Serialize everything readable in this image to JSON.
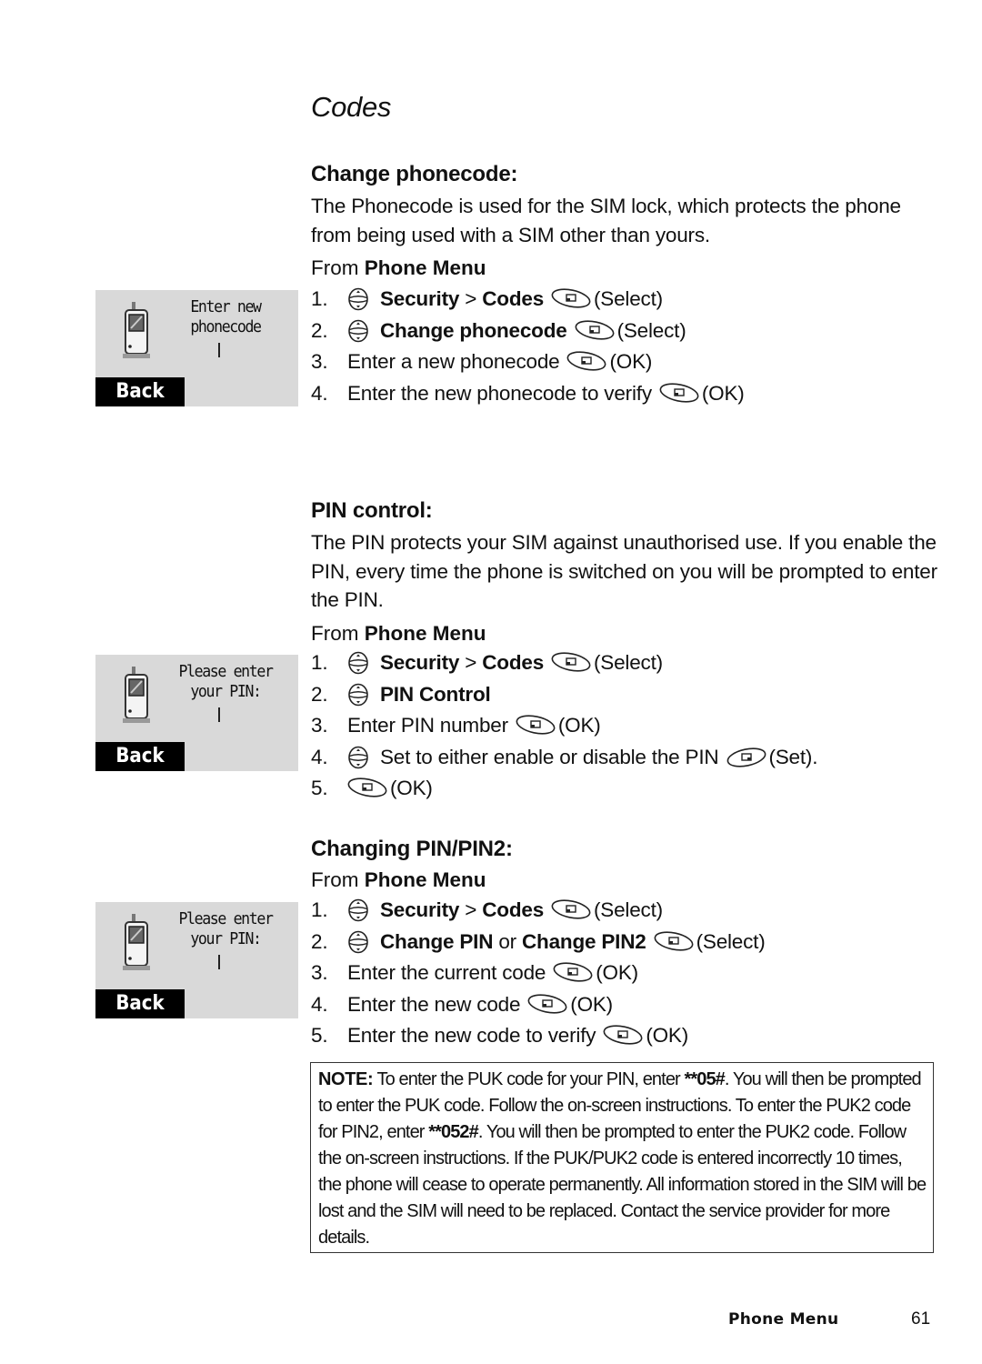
{
  "page": {
    "title": "Codes",
    "footer": {
      "section": "Phone Menu",
      "page_number": "61"
    }
  },
  "sections": [
    {
      "heading": "Change phonecode:",
      "description": "The Phonecode is used for the SIM lock, which protects the phone from being used with a SIM other than yours.",
      "from_prefix": "From",
      "from_menu": "Phone Menu",
      "screen": {
        "line1": "Enter new",
        "line2": "phonecode",
        "softkey": "Back",
        "icon": "handset-icon"
      },
      "steps": [
        {
          "num": "1.",
          "nav_icon": true,
          "bold1": "Security",
          "sep": " > ",
          "bold2": "Codes",
          "key_icon": "select-key",
          "action": "(Select)"
        },
        {
          "num": "2.",
          "nav_icon": true,
          "bold1": "Change phonecode",
          "key_icon": "select-key",
          "action": "(Select)"
        },
        {
          "num": "3.",
          "text": "Enter a new phonecode",
          "key_icon": "select-key",
          "action": "(OK)"
        },
        {
          "num": "4.",
          "text": "Enter the new phonecode to verify",
          "key_icon": "select-key",
          "action": "(OK)"
        }
      ]
    },
    {
      "heading": "PIN control:",
      "description": "The PIN protects your SIM against unauthorised use. If you enable the PIN, every time the phone is switched on you will be prompted to enter the PIN.",
      "from_prefix": "From",
      "from_menu": "Phone Menu",
      "screen": {
        "line1": "Please enter",
        "line2": "your PIN:",
        "softkey": "Back",
        "icon": "handset-icon"
      },
      "steps": [
        {
          "num": "1.",
          "nav_icon": true,
          "bold1": "Security",
          "sep": " > ",
          "bold2": "Codes",
          "key_icon": "select-key",
          "action": "(Select)"
        },
        {
          "num": "2.",
          "nav_icon": true,
          "bold1": "PIN Control"
        },
        {
          "num": "3.",
          "text": "Enter PIN number",
          "key_icon": "select-key",
          "action": "(OK)"
        },
        {
          "num": "4.",
          "nav_icon": true,
          "text": "Set to either enable or disable the PIN",
          "key_icon": "set-key",
          "action": "(Set)."
        },
        {
          "num": "5.",
          "key_icon": "select-key",
          "action": "(OK)"
        }
      ]
    },
    {
      "heading": "Changing PIN/PIN2:",
      "from_prefix": "From",
      "from_menu": "Phone Menu",
      "screen": {
        "line1": "Please enter",
        "line2": "your PIN:",
        "softkey": "Back",
        "icon": "handset-icon"
      },
      "steps": [
        {
          "num": "1.",
          "nav_icon": true,
          "bold1": "Security",
          "sep": " > ",
          "bold2": "Codes",
          "key_icon": "select-key",
          "action": "(Select)"
        },
        {
          "num": "2.",
          "nav_icon": true,
          "bold1": "Change PIN",
          "sep": " or ",
          "bold2": "Change PIN2",
          "key_icon": "select-key",
          "action": "(Select)"
        },
        {
          "num": "3.",
          "text": "Enter the current code",
          "key_icon": "select-key",
          "action": "(OK)"
        },
        {
          "num": "4.",
          "text": "Enter the new code",
          "key_icon": "select-key",
          "action": "(OK)"
        },
        {
          "num": "5.",
          "text": "Enter the new code to verify",
          "key_icon": "select-key",
          "action": "(OK)"
        }
      ]
    }
  ],
  "note": {
    "label": "NOTE:",
    "part1": " To enter the PUK code for your PIN, enter ",
    "code1": "**05#",
    "part2": ". You will then be prompted to enter the PUK code. Follow the on-screen instructions. To enter the PUK2 code for PIN2, enter ",
    "code2": "**052#",
    "part3": ". You will then be prompted to enter the PUK2 code. Follow the on-screen instructions. If the PUK/PUK2 code is entered incorrectly 10 times, the phone will cease to operate permanently. All information stored in the SIM will be lost and the SIM will need to be replaced. Contact the service provider for more details."
  }
}
